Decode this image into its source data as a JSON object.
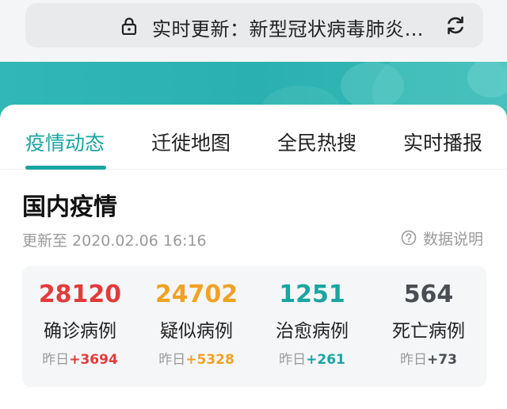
{
  "browser": {
    "url_text": "实时更新：新型冠状病毒肺炎…"
  },
  "tabs": [
    {
      "label": "疫情动态"
    },
    {
      "label": "迁徙地图"
    },
    {
      "label": "全民热搜"
    },
    {
      "label": "实时播报"
    }
  ],
  "section": {
    "title": "国内疫情",
    "update_time": "更新至 2020.02.06 16:16",
    "help_label": "数据说明"
  },
  "stats": [
    {
      "value": "28120",
      "label": "确诊病例",
      "prefix": "昨日",
      "delta": "+3694",
      "color": "#e23b3b"
    },
    {
      "value": "24702",
      "label": "疑似病例",
      "prefix": "昨日",
      "delta": "+5328",
      "color": "#f0a224"
    },
    {
      "value": "1251",
      "label": "治愈病例",
      "prefix": "昨日",
      "delta": "+261",
      "color": "#1aa5a1"
    },
    {
      "value": "564",
      "label": "死亡病例",
      "prefix": "昨日",
      "delta": "+73",
      "color": "#4a4d52"
    }
  ],
  "colors": {
    "accent": "#1aa5a1",
    "banner": "#2fb8b5"
  }
}
